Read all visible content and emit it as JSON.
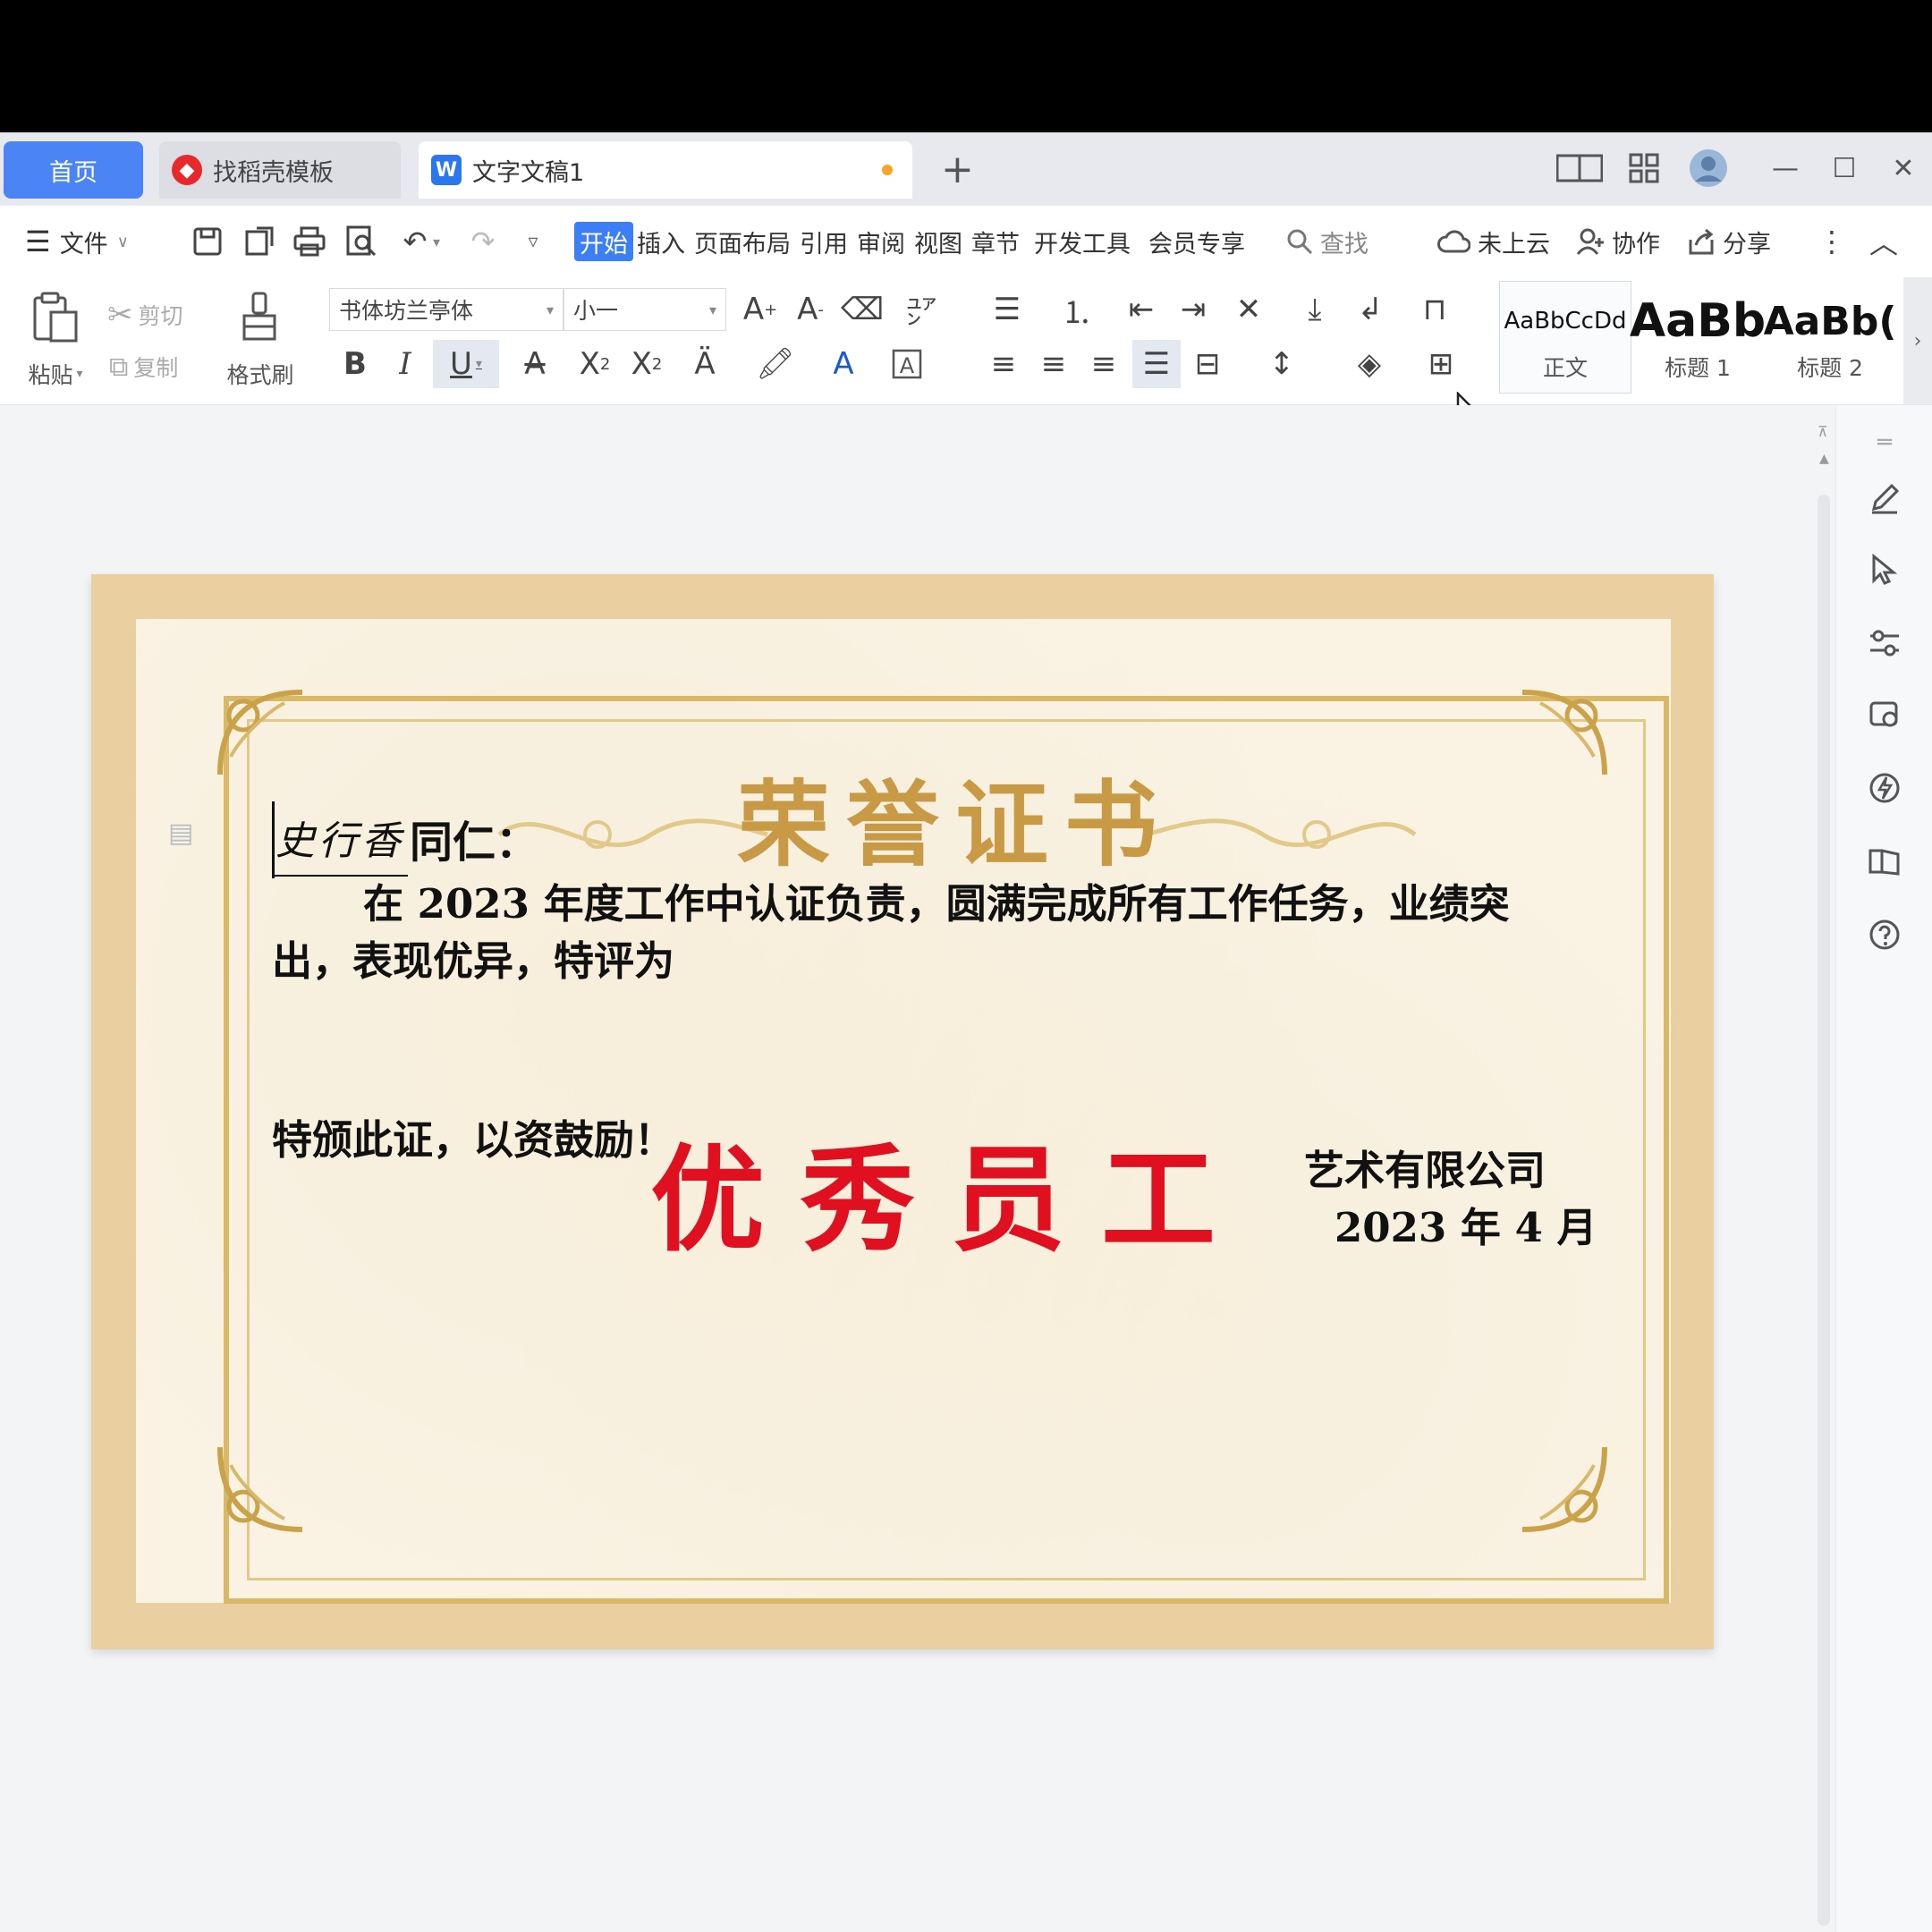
{
  "tabs": {
    "home": "首页",
    "template": "找稻壳模板",
    "document": "文字文稿1",
    "add": "+"
  },
  "window_controls": {
    "minimize": "—",
    "maximize": "☐",
    "close": "✕"
  },
  "menubar": {
    "file": "文件",
    "items": [
      "开始",
      "插入",
      "页面布局",
      "引用",
      "审阅",
      "视图",
      "章节",
      "开发工具",
      "会员专享"
    ],
    "search": "查找",
    "cloud": "未上云",
    "collab": "协作",
    "share": "分享"
  },
  "ribbon": {
    "paste": "粘贴",
    "cut": "剪切",
    "copy": "复制",
    "format_painter": "格式刷",
    "font_name": "书体坊兰亭体",
    "font_size": "小一",
    "styles": [
      {
        "preview": "AaBbCcDd",
        "name": "正文"
      },
      {
        "preview": "AaBb",
        "name": "标题 1"
      },
      {
        "preview": "AaBb(",
        "name": "标题 2"
      }
    ]
  },
  "certificate": {
    "title": "荣誉证书",
    "signature": "史行香",
    "salutation": "同仁：",
    "body_line1": "在 2023 年度工作中认证负责，圆满完成所有工作任务，业绩突",
    "body_line2": "出，表现优异，特评为",
    "award": "优秀员工",
    "closing": "特颁此证，以资鼓励！",
    "company": "艺术有限公司",
    "date": "2023 年 4 月"
  },
  "colors": {
    "accent": "#3b7ef6",
    "award_red": "#e01020",
    "title_gold": "#c99a45",
    "frame_gold": "#d9b867",
    "page_border": "#ead0a0"
  }
}
